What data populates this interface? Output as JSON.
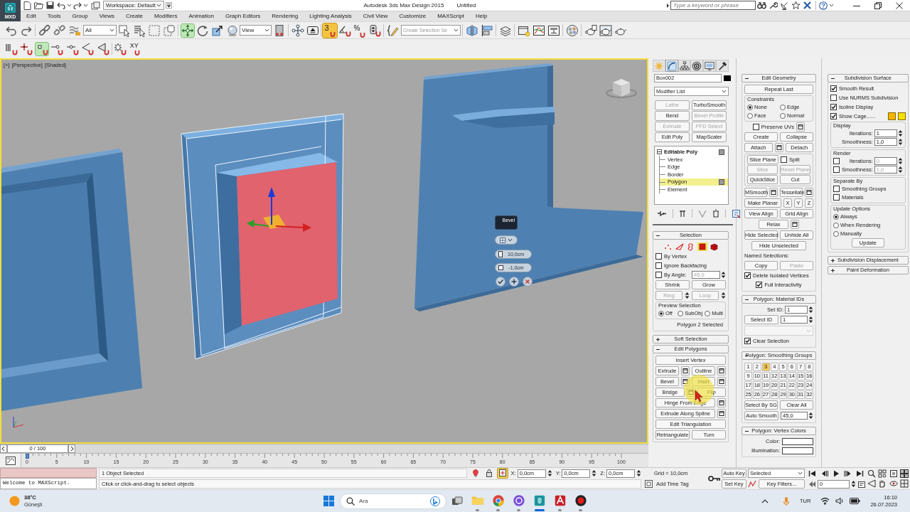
{
  "title_bar": {
    "logo": "MXD",
    "workspace": "Workspace: Default",
    "title": "Autodesk 3ds Max Design 2015",
    "document": "Untitled",
    "search": {
      "placeholder": "Type a keyword or phrase"
    }
  },
  "menu": [
    "Edit",
    "Tools",
    "Group",
    "Views",
    "Create",
    "Modifiers",
    "Animation",
    "Graph Editors",
    "Rendering",
    "Lighting Analysis",
    "Civil View",
    "Customize",
    "MAXScript",
    "Help"
  ],
  "main_toolbar": {
    "selection_filter": "All",
    "transform_tools": [
      {
        "selected": true
      },
      {
        "selected": false
      },
      {
        "selected": false
      },
      {
        "selected": false
      }
    ],
    "reference_coordinate": "View",
    "snap_toggle": {
      "label": "3",
      "on": true
    },
    "percent_snap": {
      "label": "%"
    },
    "named_selection": {
      "placeholder": "Create Selection Se"
    }
  },
  "snap_toolbar": {
    "tools": [
      {
        "selected": false
      },
      {
        "selected": false
      },
      {
        "selected": true
      },
      {
        "selected": false
      },
      {
        "selected": false
      },
      {
        "selected": false
      },
      {
        "selected": false
      },
      {
        "selected": false
      }
    ],
    "axis_label": "XY"
  },
  "viewport": {
    "labels": [
      "[+]",
      "[Perspective]",
      "[Shaded]"
    ],
    "caddy": {
      "title": "Bevel",
      "height": "10,0cm",
      "outline": "-1,0cm"
    }
  },
  "command_panel": {
    "tabs": [
      {
        "selected": false
      },
      {
        "selected": true
      },
      {
        "selected": false
      },
      {
        "selected": false
      },
      {
        "selected": false
      },
      {
        "selected": false
      }
    ],
    "object_name": "Box002",
    "modifier_list": "Modifier List",
    "modifier_buttons": [
      {
        "label": "Lathe",
        "disabled": true
      },
      {
        "label": "TurboSmooth",
        "disabled": false
      },
      {
        "label": "Bend",
        "disabled": false
      },
      {
        "label": "Bevel Profile",
        "disabled": true
      },
      {
        "label": "Extrude",
        "disabled": true
      },
      {
        "label": "FFD Select",
        "disabled": true
      },
      {
        "label": "Edit Poly",
        "disabled": false
      },
      {
        "label": "MapScaler",
        "disabled": false
      }
    ],
    "stack": [
      {
        "label": "Editable Poly",
        "expanded": true,
        "children": [
          {
            "label": "Vertex",
            "selected": false
          },
          {
            "label": "Edge",
            "selected": false
          },
          {
            "label": "Border",
            "selected": false
          },
          {
            "label": "Polygon",
            "selected": true
          },
          {
            "label": "Element",
            "selected": false
          }
        ]
      }
    ],
    "rollouts": [
      [
        {
          "title": "Selection",
          "expanded": true,
          "rows": [
            {
              "kind": "subobjects",
              "items": [
                {
                  "selected": false
                },
                {
                  "selected": false
                },
                {
                  "selected": false
                },
                {
                  "selected": true
                },
                {
                  "selected": false
                }
              ]
            },
            {
              "kind": "row",
              "items": [
                {
                  "kind": "check",
                  "label": "By Vertex",
                  "checked": false
                }
              ]
            },
            {
              "kind": "row",
              "items": [
                {
                  "kind": "check",
                  "label": "Ignore Backfacing",
                  "checked": false
                }
              ]
            },
            {
              "kind": "row",
              "items": [
                {
                  "kind": "check",
                  "label": "By Angle:",
                  "checked": false
                },
                {
                  "kind": "spinner",
                  "value": "45,0",
                  "disabled": true
                }
              ]
            },
            {
              "kind": "row",
              "items": [
                {
                  "kind": "button",
                  "label": "Shrink",
                  "disabled": false
                },
                {
                  "kind": "button",
                  "label": "Grow",
                  "disabled": false
                }
              ]
            },
            {
              "kind": "row",
              "items": [
                {
                  "kind": "spinbutton",
                  "label": "Ring",
                  "disabled": true
                },
                {
                  "kind": "spinbutton",
                  "label": "Loop",
                  "disabled": true
                }
              ]
            },
            {
              "kind": "group",
              "title": "Preview Selection",
              "rows": [
                {
                  "kind": "row",
                  "items": [
                    {
                      "kind": "radio",
                      "label": "Off",
                      "selected": true
                    },
                    {
                      "kind": "radio",
                      "label": "SubObj",
                      "selected": false
                    },
                    {
                      "kind": "radio",
                      "label": "Multi",
                      "selected": false
                    }
                  ]
                }
              ]
            },
            {
              "kind": "end",
              "items": [
                {
                  "kind": "text",
                  "text": "Polygon 2 Selected"
                }
              ]
            }
          ]
        },
        {
          "title": "Soft Selection",
          "expanded": false
        },
        {
          "title": "Edit Polygons",
          "expanded": true,
          "rows": [
            {
              "kind": "row",
              "items": [
                {
                  "kind": "button",
                  "label": "Insert Vertex",
                  "disabled": false
                }
              ]
            },
            {
              "kind": "row",
              "items": [
                {
                  "kind": "button",
                  "label": "Extrude",
                  "disabled": false,
                  "settings": true
                },
                {
                  "kind": "button",
                  "label": "Outline",
                  "disabled": false,
                  "settings": true
                }
              ]
            },
            {
              "kind": "row",
              "items": [
                {
                  "kind": "button",
                  "label": "Bevel",
                  "disabled": false,
                  "settings": true
                },
                {
                  "kind": "button",
                  "label": "Inset",
                  "disabled": false,
                  "settings": true
                }
              ]
            },
            {
              "kind": "row",
              "items": [
                {
                  "kind": "button",
                  "label": "Bridge",
                  "disabled": false,
                  "settings": true
                },
                {
                  "kind": "button",
                  "label": "Flip",
                  "disabled": false
                }
              ]
            },
            {
              "kind": "row",
              "items": [
                {
                  "kind": "button",
                  "label": "Hinge From Edge",
                  "disabled": false,
                  "settings": true
                }
              ]
            },
            {
              "kind": "row",
              "items": [
                {
                  "kind": "button",
                  "label": "Extrude Along Spline",
                  "disabled": false,
                  "settings": true
                }
              ]
            },
            {
              "kind": "row",
              "items": [
                {
                  "kind": "button",
                  "label": "Edit Triangulation",
                  "disabled": false
                }
              ]
            },
            {
              "kind": "row",
              "items": [
                {
                  "kind": "button",
                  "label": "Retriangulate",
                  "disabled": false
                },
                {
                  "kind": "button",
                  "label": "Turn",
                  "disabled": false
                }
              ]
            }
          ]
        }
      ],
      [
        {
          "title": "Edit Geometry",
          "expanded": true,
          "rows": [
            {
              "kind": "row",
              "items": [
                {
                  "kind": "button",
                  "label": "Repeat Last",
                  "disabled": false
                }
              ]
            },
            {
              "kind": "group",
              "title": "Constraints",
              "rows": [
                {
                  "kind": "row",
                  "items": [
                    {
                      "kind": "radio",
                      "label": "None",
                      "selected": true
                    },
                    {
                      "kind": "radio",
                      "label": "Edge",
                      "selected": false
                    }
                  ]
                },
                {
                  "kind": "row",
                  "items": [
                    {
                      "kind": "radio",
                      "label": "Face",
                      "selected": false
                    },
                    {
                      "kind": "radio",
                      "label": "Normal",
                      "selected": false
                    }
                  ]
                }
              ]
            },
            {
              "kind": "center",
              "items": [
                {
                  "kind": "check",
                  "label": "Preserve UVs",
                  "checked": false,
                  "settings": true
                }
              ]
            },
            {
              "kind": "row",
              "items": [
                {
                  "kind": "button",
                  "label": "Create",
                  "disabled": false
                },
                {
                  "kind": "button",
                  "label": "Collapse",
                  "disabled": false
                }
              ]
            },
            {
              "kind": "row",
              "items": [
                {
                  "kind": "button",
                  "label": "Attach",
                  "disabled": false,
                  "settings": true
                },
                {
                  "kind": "button",
                  "label": "Detach",
                  "disabled": false
                }
              ]
            },
            {
              "kind": "group",
              "rows": [
                {
                  "kind": "row",
                  "items": [
                    {
                      "kind": "button",
                      "label": "Slice Plane",
                      "disabled": false
                    },
                    {
                      "kind": "check",
                      "label": "Split",
                      "checked": false
                    }
                  ]
                },
                {
                  "kind": "row",
                  "items": [
                    {
                      "kind": "button",
                      "label": "Slice",
                      "disabled": true
                    },
                    {
                      "kind": "button",
                      "label": "Reset Plane",
                      "disabled": true
                    }
                  ]
                },
                {
                  "kind": "row",
                  "items": [
                    {
                      "kind": "button",
                      "label": "QuickSlice",
                      "disabled": false
                    },
                    {
                      "kind": "button",
                      "label": "Cut",
                      "disabled": false
                    }
                  ]
                }
              ]
            },
            {
              "kind": "row",
              "items": [
                {
                  "kind": "button",
                  "label": "MSmooth",
                  "disabled": false,
                  "settings": true
                },
                {
                  "kind": "button",
                  "label": "Tessellate",
                  "disabled": false,
                  "settings": true
                }
              ]
            },
            {
              "kind": "row",
              "items": [
                {
                  "kind": "button",
                  "label": "Make Planar",
                  "disabled": false
                },
                {
                  "kind": "letter",
                  "label": "X",
                  "disabled": false
                },
                {
                  "kind": "letter",
                  "label": "Y",
                  "disabled": false
                },
                {
                  "kind": "letter",
                  "label": "Z",
                  "disabled": false
                }
              ]
            },
            {
              "kind": "row",
              "items": [
                {
                  "kind": "button",
                  "label": "View Align",
                  "disabled": false
                },
                {
                  "kind": "button",
                  "label": "Grid Align",
                  "disabled": false
                }
              ]
            },
            {
              "kind": "center",
              "items": [
                {
                  "kind": "button",
                  "label": "Relax",
                  "disabled": false,
                  "settings": true
                }
              ]
            },
            {
              "kind": "row",
              "items": [
                {
                  "kind": "button",
                  "label": "Hide Selected",
                  "disabled": false
                },
                {
                  "kind": "button",
                  "label": "Unhide All",
                  "disabled": false
                }
              ]
            },
            {
              "kind": "center",
              "items": [
                {
                  "kind": "button",
                  "label": "Hide Unselected",
                  "disabled": false
                }
              ]
            },
            {
              "kind": "row",
              "items": [
                {
                  "kind": "text",
                  "text": "Named Selections:"
                }
              ]
            },
            {
              "kind": "row",
              "items": [
                {
                  "kind": "button",
                  "label": "Copy",
                  "disabled": false
                },
                {
                  "kind": "button",
                  "label": "Paste",
                  "disabled": true
                }
              ]
            },
            {
              "kind": "row",
              "items": [
                {
                  "kind": "check",
                  "label": "Delete Isolated Vertices",
                  "checked": true
                }
              ]
            },
            {
              "kind": "center",
              "items": [
                {
                  "kind": "check",
                  "label": "Full Interactivity",
                  "checked": true
                }
              ]
            }
          ]
        },
        {
          "title": "Polygon: Material IDs",
          "expanded": true,
          "rows": [
            {
              "kind": "row",
              "items": [
                {
                  "kind": "spinner",
                  "label": "Set ID:",
                  "value": "1",
                  "disabled": false
                }
              ]
            },
            {
              "kind": "row",
              "items": [
                {
                  "kind": "button",
                  "label": "Select ID",
                  "disabled": false
                },
                {
                  "kind": "spinner",
                  "value": "1",
                  "disabled": false
                }
              ]
            },
            {
              "kind": "row",
              "items": [
                {
                  "kind": "dropdown",
                  "disabled": true
                }
              ]
            },
            {
              "kind": "row",
              "items": [
                {
                  "kind": "check",
                  "label": "Clear Selection",
                  "checked": true
                }
              ]
            }
          ]
        },
        {
          "title": "Polygon: Smoothing Groups",
          "expanded": true,
          "rows": [
            {
              "kind": "grid",
              "items": [
                {
                  "label": "1",
                  "selected": false
                },
                {
                  "label": "2",
                  "selected": false
                },
                {
                  "label": "3",
                  "selected": true
                },
                {
                  "label": "4",
                  "selected": false
                },
                {
                  "label": "5",
                  "selected": false
                },
                {
                  "label": "6",
                  "selected": false
                },
                {
                  "label": "7",
                  "selected": false
                },
                {
                  "label": "8",
                  "selected": false
                },
                {
                  "label": "9",
                  "selected": false
                },
                {
                  "label": "10",
                  "selected": false
                },
                {
                  "label": "11",
                  "selected": false
                },
                {
                  "label": "12",
                  "selected": false
                },
                {
                  "label": "13",
                  "selected": false
                },
                {
                  "label": "14",
                  "selected": false
                },
                {
                  "label": "15",
                  "selected": false
                },
                {
                  "label": "16",
                  "selected": false
                },
                {
                  "label": "17",
                  "selected": false
                },
                {
                  "label": "18",
                  "selected": false
                },
                {
                  "label": "19",
                  "selected": false
                },
                {
                  "label": "20",
                  "selected": false
                },
                {
                  "label": "21",
                  "selected": false
                },
                {
                  "label": "22",
                  "selected": false
                },
                {
                  "label": "23",
                  "selected": false
                },
                {
                  "label": "24",
                  "selected": false
                },
                {
                  "label": "25",
                  "selected": false
                },
                {
                  "label": "26",
                  "selected": false
                },
                {
                  "label": "27",
                  "selected": false
                },
                {
                  "label": "28",
                  "selected": false
                },
                {
                  "label": "29",
                  "selected": false
                },
                {
                  "label": "30",
                  "selected": false
                },
                {
                  "label": "31",
                  "selected": false
                },
                {
                  "label": "32",
                  "selected": false
                }
              ]
            },
            {
              "kind": "row",
              "items": [
                {
                  "kind": "button",
                  "label": "Select By SG",
                  "disabled": false
                },
                {
                  "kind": "button",
                  "label": "Clear All",
                  "disabled": false
                }
              ]
            },
            {
              "kind": "row",
              "items": [
                {
                  "kind": "button",
                  "label": "Auto Smooth",
                  "disabled": false
                },
                {
                  "kind": "spinner",
                  "value": "45,0",
                  "disabled": false
                }
              ]
            }
          ]
        },
        {
          "title": "Polygon: Vertex Colors",
          "expanded": true,
          "rows": [
            {
              "kind": "row",
              "items": [
                {
                  "kind": "swatch",
                  "label": "Color:"
                }
              ]
            },
            {
              "kind": "row",
              "items": [
                {
                  "kind": "swatch",
                  "label": "Illumination:"
                }
              ]
            }
          ]
        }
      ],
      [
        {
          "title": "Subdivision Surface",
          "expanded": true,
          "rows": [
            {
              "kind": "row",
              "items": [
                {
                  "kind": "check",
                  "label": "Smooth Result",
                  "checked": true
                }
              ]
            },
            {
              "kind": "row",
              "items": [
                {
                  "kind": "check",
                  "label": "Use NURMS Subdivision",
                  "checked": false
                }
              ]
            },
            {
              "kind": "row",
              "items": [
                {
                  "kind": "check",
                  "label": "Isoline Display",
                  "checked": true
                }
              ]
            },
            {
              "kind": "row",
              "items": [
                {
                  "kind": "check",
                  "label": "Show Cage......",
                  "checked": true
                },
                {
                  "kind": "color",
                  "color": "#f5b400"
                },
                {
                  "kind": "color",
                  "color": "#f5e000"
                }
              ]
            },
            {
              "kind": "group",
              "title": "Display",
              "rows": [
                {
                  "kind": "row",
                  "items": [
                    {
                      "kind": "spinner",
                      "label": "Iterations:",
                      "value": "1",
                      "disabled": false
                    }
                  ]
                },
                {
                  "kind": "row",
                  "items": [
                    {
                      "kind": "spinner",
                      "label": "Smoothness:",
                      "value": "1,0",
                      "disabled": false
                    }
                  ]
                }
              ]
            },
            {
              "kind": "group",
              "title": "Render",
              "rows": [
                {
                  "kind": "row",
                  "items": [
                    {
                      "kind": "check",
                      "checked": false
                    },
                    {
                      "kind": "spinner",
                      "label": "Iterations:",
                      "value": "0",
                      "disabled": true
                    }
                  ]
                },
                {
                  "kind": "row",
                  "items": [
                    {
                      "kind": "check",
                      "checked": false
                    },
                    {
                      "kind": "spinner",
                      "label": "Smoothness:",
                      "value": "1,0",
                      "disabled": true
                    }
                  ]
                }
              ]
            },
            {
              "kind": "group",
              "title": "Separate By",
              "rows": [
                {
                  "kind": "row",
                  "items": [
                    {
                      "kind": "check",
                      "label": "Smoothing Groups",
                      "checked": false
                    }
                  ]
                },
                {
                  "kind": "row",
                  "items": [
                    {
                      "kind": "check",
                      "label": "Materials",
                      "checked": false
                    }
                  ]
                }
              ]
            },
            {
              "kind": "group",
              "title": "Update Options",
              "rows": [
                {
                  "kind": "row",
                  "items": [
                    {
                      "kind": "radio",
                      "label": "Always",
                      "selected": true
                    }
                  ]
                },
                {
                  "kind": "row",
                  "items": [
                    {
                      "kind": "radio",
                      "label": "When Rendering",
                      "selected": false
                    }
                  ]
                },
                {
                  "kind": "row",
                  "items": [
                    {
                      "kind": "radio",
                      "label": "Manually",
                      "selected": false
                    }
                  ]
                },
                {
                  "kind": "center",
                  "items": [
                    {
                      "kind": "button",
                      "label": "Update",
                      "disabled": false
                    }
                  ]
                }
              ]
            }
          ]
        },
        {
          "title": "Subdivision Displacement",
          "expanded": false
        },
        {
          "title": "Paint Deformation",
          "expanded": false
        }
      ]
    ]
  },
  "timeline": {
    "slider": {
      "label": "0 / 100",
      "level": 0
    },
    "ticks": [
      "0",
      "5",
      "10",
      "15",
      "20",
      "25",
      "30",
      "35",
      "40",
      "45",
      "50",
      "55",
      "60",
      "65",
      "70",
      "75",
      "80",
      "85",
      "90",
      "95",
      "100"
    ]
  },
  "status_bar": {
    "listener": "Welcome to MAXScript.",
    "status": "1 Object Selected",
    "prompt": "Click or click-and-drag to select objects",
    "mode_icons": [
      {
        "selected": false
      },
      {
        "selected": false
      },
      {
        "selected": true
      }
    ],
    "coordinates": [
      {
        "label": "X:",
        "value": "0,0cm"
      },
      {
        "label": "Y:",
        "value": "0,0cm"
      },
      {
        "label": "Z:",
        "value": "0,0cm"
      }
    ],
    "grid": "Grid = 10,0cm",
    "time_tag": "Add Time Tag",
    "auto_key": "Auto Key",
    "set_key": "Set Key",
    "key_mode": "Selected",
    "key_filters": "Key Filters...",
    "frame": "0"
  },
  "taskbar": {
    "weather": {
      "temperature": "38°C",
      "condition": "Güneşli"
    },
    "search": {
      "placeholder": "Ara"
    },
    "apps": [
      {
        "selected": false
      },
      {
        "selected": false
      },
      {
        "selected": false
      },
      {
        "selected": true
      },
      {
        "selected": false
      },
      {
        "selected": false
      }
    ],
    "language": "TUR",
    "time": "16:10",
    "date": "26.07.2023"
  }
}
